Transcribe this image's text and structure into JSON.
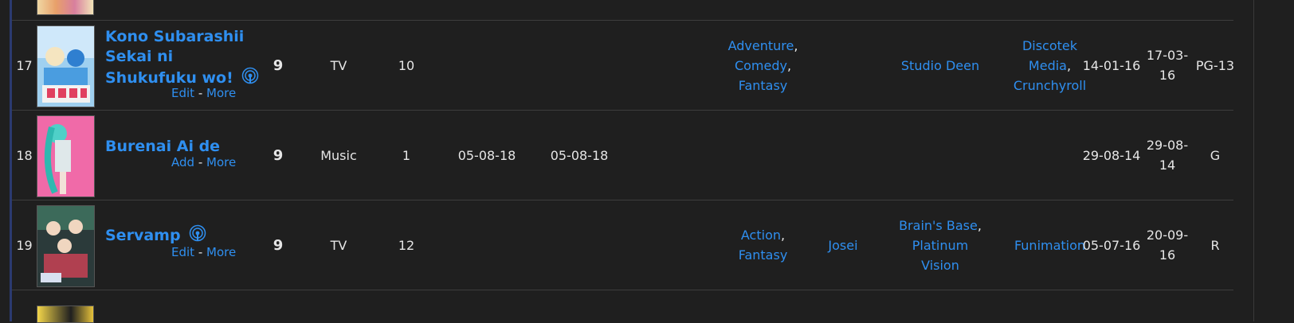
{
  "rows": [
    {
      "num": "17",
      "title": "Kono Subarashii Sekai ni Shukufuku wo!",
      "title_lines": [
        "Kono Subarashii",
        "Sekai ni",
        "Shukufuku wo!"
      ],
      "airing": true,
      "action": "Edit",
      "more": "More",
      "score": "9",
      "type": "TV",
      "episodes": "10",
      "start": "",
      "end": "",
      "genres": [
        "Adventure",
        "Comedy",
        "Fantasy"
      ],
      "demographic": "",
      "studios": [
        "Studio Deen"
      ],
      "licensors": [
        "Discotek Media",
        "Crunchyroll"
      ],
      "aired_start": "14-01-16",
      "aired_end": "17-03-16",
      "rating": "PG-13"
    },
    {
      "num": "18",
      "title": "Burenai Ai de",
      "airing": false,
      "action": "Add",
      "more": "More",
      "score": "9",
      "type": "Music",
      "episodes": "1",
      "start": "05-08-18",
      "end": "05-08-18",
      "genres": [],
      "demographic": "",
      "studios": [],
      "licensors": [],
      "aired_start": "29-08-14",
      "aired_end": "29-08-14",
      "rating": "G"
    },
    {
      "num": "19",
      "title": "Servamp",
      "airing": true,
      "action": "Edit",
      "more": "More",
      "score": "9",
      "type": "TV",
      "episodes": "12",
      "start": "",
      "end": "",
      "genres": [
        "Action",
        "Fantasy"
      ],
      "demographic": "Josei",
      "studios": [
        "Brain's Base",
        "Platinum Vision"
      ],
      "licensors": [
        "Funimation"
      ],
      "aired_start": "05-07-16",
      "aired_end": "20-09-16",
      "rating": "R"
    }
  ],
  "separator": " - ",
  "colors": {
    "link": "#2f8ff0",
    "background": "#1f1f1f",
    "text": "#e6e6e6"
  },
  "icons": {
    "airing": "broadcast-icon"
  }
}
